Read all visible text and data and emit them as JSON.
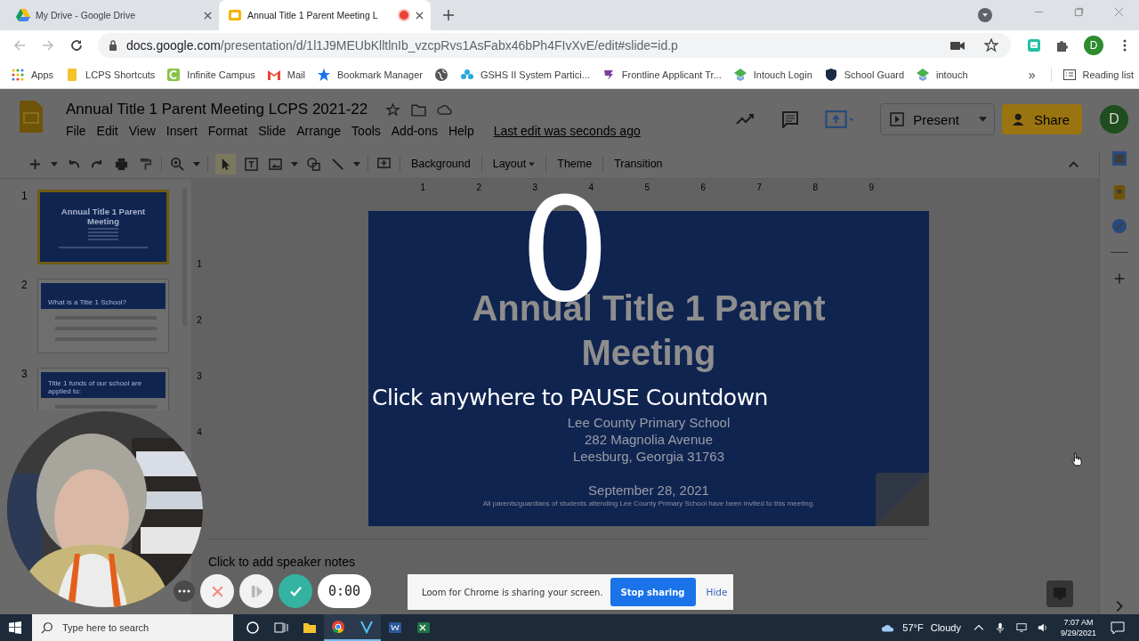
{
  "browser": {
    "tabs": [
      {
        "title": "My Drive - Google Drive",
        "selected": false,
        "recording": false
      },
      {
        "title": "Annual Title 1 Parent Meeting L",
        "selected": true,
        "recording": true
      }
    ],
    "url_host": "docs.google.com",
    "url_path": "/presentation/d/1l1J9MEUbKlltlnIb_vzcpRvs1AsFabx46bPh4FIvXvE/edit#slide=id.p",
    "profile_initial": "D",
    "bookmarks": [
      {
        "kind": "link",
        "label": "Apps"
      },
      {
        "kind": "link",
        "label": "LCPS Shortcuts"
      },
      {
        "kind": "link",
        "label": "Infinite Campus"
      },
      {
        "kind": "link",
        "label": "Mail"
      },
      {
        "kind": "link",
        "label": "Bookmark Manager"
      },
      {
        "kind": "icon-only"
      },
      {
        "kind": "link",
        "label": "GSHS II System Partici..."
      },
      {
        "kind": "link",
        "label": "Frontline Applicant Tr..."
      },
      {
        "kind": "link",
        "label": "Intouch Login"
      },
      {
        "kind": "link",
        "label": "School Guard"
      },
      {
        "kind": "link",
        "label": "intouch"
      }
    ],
    "bookmarks_more": "»",
    "reading_list": "Reading list"
  },
  "slides_app": {
    "title": "Annual Title 1 Parent Meeting LCPS 2021-22",
    "menu": [
      "File",
      "Edit",
      "View",
      "Insert",
      "Format",
      "Slide",
      "Arrange",
      "Tools",
      "Add-ons",
      "Help"
    ],
    "last_edit": "Last edit was seconds ago",
    "present": "Present",
    "share": "Share",
    "avatar": "D",
    "toolbar_buttons": [
      {
        "label": "Background",
        "dropdown": false
      },
      {
        "label": "Layout",
        "dropdown": true
      },
      {
        "label": "Theme",
        "dropdown": false
      },
      {
        "label": "Transition",
        "dropdown": false
      }
    ],
    "ruler_h": [
      "1",
      "2",
      "3",
      "4",
      "5",
      "6",
      "7",
      "8",
      "9"
    ],
    "ruler_v": [
      "1",
      "2",
      "3",
      "4"
    ],
    "thumbnails": [
      {
        "number": "1",
        "kind": "title",
        "title": "Annual Title 1 Parent Meeting",
        "selected": true
      },
      {
        "number": "2",
        "kind": "content",
        "title": "What is a Title 1 School?",
        "selected": false
      },
      {
        "number": "3",
        "kind": "content",
        "title": "Title 1 funds of our school are applied to:",
        "selected": false
      }
    ],
    "slide": {
      "title": "Annual Title 1 Parent Meeting",
      "lines": [
        "Lee County Primary School",
        "282 Magnolia Avenue",
        "Leesburg, Georgia 31763"
      ],
      "date": "September 28, 2021",
      "footnote": "All parents/guardians of students attending Lee County Primary School have been invited to this meeting."
    },
    "speaker_notes_placeholder": "Click to add speaker notes"
  },
  "countdown": {
    "number": "0",
    "hint": "Click anywhere to PAUSE Countdown"
  },
  "recorder": {
    "timer": "0:00"
  },
  "share_bar": {
    "message": "Loom for Chrome is sharing your screen.",
    "stop": "Stop sharing",
    "hide": "Hide"
  },
  "taskbar": {
    "search_placeholder": "Type here to search",
    "temperature": "57°F",
    "condition": "Cloudy",
    "time": "7:07 AM",
    "date": "9/29/2021"
  }
}
